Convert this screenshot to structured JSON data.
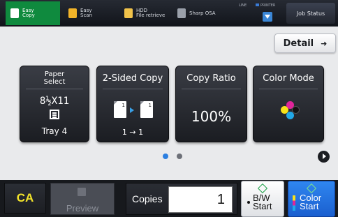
{
  "top_bar": {
    "tabs": [
      {
        "line1": "Easy",
        "line2": "Copy",
        "icon": "copy-icon",
        "active": true
      },
      {
        "line1": "Easy",
        "line2": "Scan",
        "icon": "scan-icon",
        "active": false
      },
      {
        "line1": "HDD",
        "line2": "File retrieve",
        "icon": "folder-icon",
        "active": false
      },
      {
        "line1": "Sharp OSA",
        "line2": "",
        "icon": "osa-icon",
        "active": false
      }
    ],
    "status": {
      "line_label": "LINE",
      "printer_label": "PRINTER",
      "icon": "download-icon"
    },
    "job_status_label": "Job Status"
  },
  "detail_label": "Detail",
  "function_keys": {
    "paper_select": {
      "title_line1": "Paper",
      "title_line2": "Select",
      "size": "8½X11",
      "tray": "Tray 4"
    },
    "two_sided": {
      "title": "2-Sided Copy",
      "page_label": "1",
      "value": "1 → 1"
    },
    "copy_ratio": {
      "title": "Copy Ratio",
      "value": "100%"
    },
    "color_mode": {
      "title": "Color Mode"
    }
  },
  "pager": {
    "current_page": 1,
    "total_pages": 2
  },
  "bottom_bar": {
    "ca_label": "CA",
    "preview_label": "Preview",
    "copies_label": "Copies",
    "copies_value": "1",
    "bw_start": {
      "line1": "B/W",
      "line2": "Start"
    },
    "color_start": {
      "line1": "Color",
      "line2": "Start"
    }
  },
  "colors": {
    "accent_green": "#0f8a3e",
    "color_start_blue": "#2f86f0",
    "ca_yellow": "#f3e42a"
  }
}
